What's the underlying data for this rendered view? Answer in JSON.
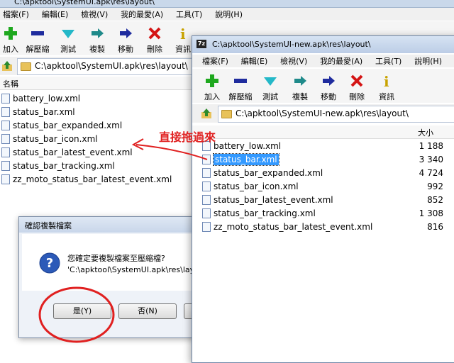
{
  "back_window": {
    "title": "C:\\apktool\\SystemUI.apk\\res\\layout\\",
    "menu": [
      "檔案(F)",
      "編輯(E)",
      "檢視(V)",
      "我的最愛(A)",
      "工具(T)",
      "說明(H)"
    ],
    "toolbar": [
      "加入",
      "解壓縮",
      "測試",
      "複製",
      "移動",
      "刪除",
      "資訊"
    ],
    "address": "C:\\apktool\\SystemUI.apk\\res\\layout\\",
    "col_name": "名稱",
    "files": [
      "battery_low.xml",
      "status_bar.xml",
      "status_bar_expanded.xml",
      "status_bar_icon.xml",
      "status_bar_latest_event.xml",
      "status_bar_tracking.xml",
      "zz_moto_status_bar_latest_event.xml"
    ]
  },
  "dialog": {
    "title": "確認複製檔案",
    "message": "您確定要複製檔案至壓縮檔?",
    "path": "'C:\\apktool\\SystemUI.apk\\res\\layout",
    "yes": "是(Y)",
    "no": "否(N)"
  },
  "annotation": {
    "text": "直接拖過來",
    "color": "#e02020"
  },
  "front_window": {
    "app_icon": "7z",
    "title": "C:\\apktool\\SystemUI-new.apk\\res\\layout\\",
    "menu": [
      "檔案(F)",
      "編輯(E)",
      "檢視(V)",
      "我的最愛(A)",
      "工具(T)",
      "說明(H)"
    ],
    "toolbar": [
      "加入",
      "解壓縮",
      "測試",
      "複製",
      "移動",
      "刪除",
      "資訊"
    ],
    "address": "C:\\apktool\\SystemUI-new.apk\\res\\layout\\",
    "col_size": "大小",
    "files": [
      {
        "name": "battery_low.xml",
        "size": "1 188"
      },
      {
        "name": "status_bar.xml",
        "size": "3 340"
      },
      {
        "name": "status_bar_expanded.xml",
        "size": "4 724"
      },
      {
        "name": "status_bar_icon.xml",
        "size": "992"
      },
      {
        "name": "status_bar_latest_event.xml",
        "size": "852"
      },
      {
        "name": "status_bar_tracking.xml",
        "size": "1 308"
      },
      {
        "name": "zz_moto_status_bar_latest_event.xml",
        "size": "816"
      }
    ],
    "selected_index": 1
  }
}
